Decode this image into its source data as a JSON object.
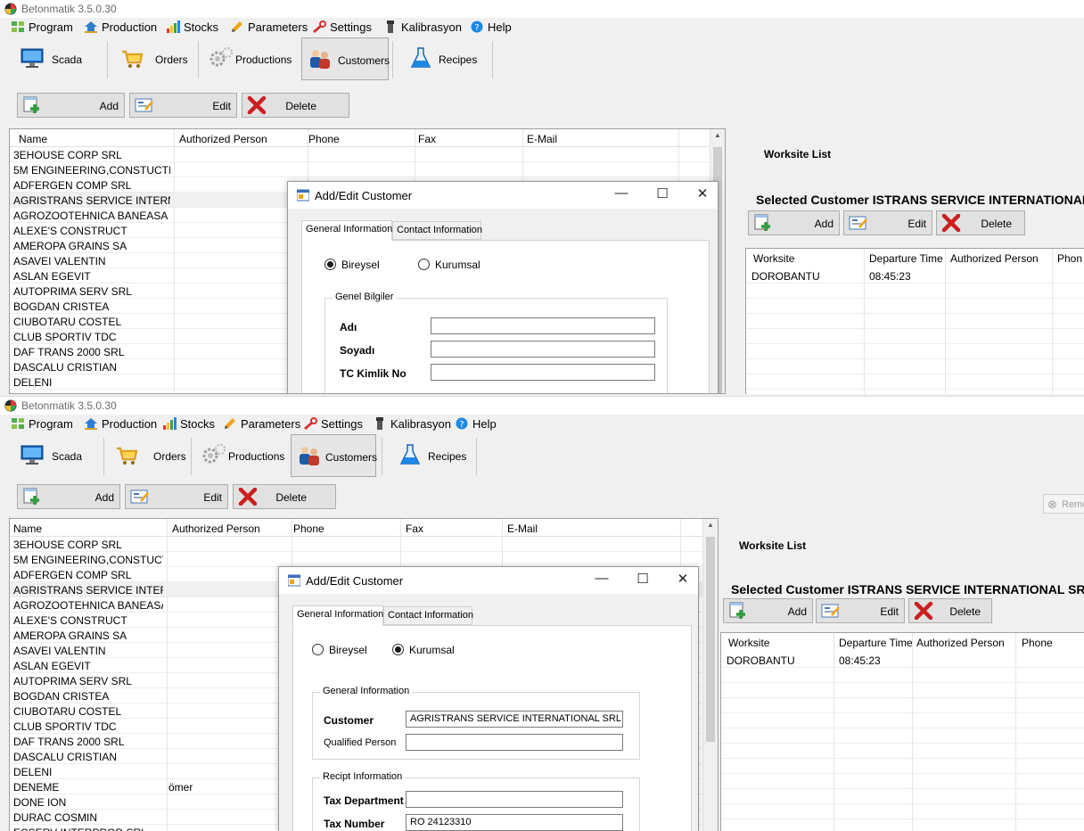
{
  "app": {
    "title": "Betonmatik 3.5.0.30"
  },
  "menu": [
    "Program",
    "Production",
    "Stocks",
    "Parameters",
    "Settings",
    "Kalibrasyon",
    "Help"
  ],
  "modules": [
    "Scada",
    "Orders",
    "Productions",
    "Customers",
    "Recipes"
  ],
  "toolbar": {
    "add": "Add",
    "edit": "Edit",
    "delete": "Delete"
  },
  "customer_columns": [
    "Name",
    "Authorized Person",
    "Phone",
    "Fax",
    "E-Mail"
  ],
  "customers": [
    {
      "name": "3EHOUSE CORP SRL",
      "person": ""
    },
    {
      "name": "5M ENGINEERING,CONSTUCTI...",
      "person": ""
    },
    {
      "name": "ADFERGEN COMP SRL",
      "person": ""
    },
    {
      "name": "AGRISTRANS SERVICE INTERN...",
      "person": ""
    },
    {
      "name": "AGROZOOTEHNICA BANEASA ...",
      "person": ""
    },
    {
      "name": "ALEXE'S CONSTRUCT",
      "person": ""
    },
    {
      "name": "AMEROPA GRAINS SA",
      "person": ""
    },
    {
      "name": "ASAVEI VALENTIN",
      "person": ""
    },
    {
      "name": "ASLAN EGEVIT",
      "person": ""
    },
    {
      "name": "AUTOPRIMA SERV SRL",
      "person": ""
    },
    {
      "name": "BOGDAN CRISTEA",
      "person": ""
    },
    {
      "name": "CIUBOTARU COSTEL",
      "person": ""
    },
    {
      "name": "CLUB SPORTIV TDC",
      "person": ""
    },
    {
      "name": "DAF TRANS 2000 SRL",
      "person": ""
    },
    {
      "name": "DASCALU CRISTIAN",
      "person": ""
    },
    {
      "name": "DELENI",
      "person": ""
    },
    {
      "name": "DENEME",
      "person": "ömer"
    },
    {
      "name": "DONE ION",
      "person": ""
    },
    {
      "name": "DURAC COSMIN",
      "person": ""
    },
    {
      "name": "ECSERV INTERPROD SRL",
      "person": ""
    }
  ],
  "worksite": {
    "list_label": "Worksite List",
    "selected_top": "Selected Customer ISTRANS SERVICE INTERNATIONAL",
    "selected_bottom": "Selected Customer ISTRANS SERVICE INTERNATIONAL SRL",
    "columns_top": [
      "Worksite",
      "Departure Time",
      "Authorized Person",
      "Phon"
    ],
    "columns_bottom": [
      "Worksite",
      "Departure Time",
      "Authorized Person",
      "Phone"
    ],
    "rows": [
      {
        "worksite": "DOROBANTU",
        "time": "08:45:23"
      }
    ]
  },
  "remove_button": "Remo",
  "dialog": {
    "title": "Add/Edit Customer",
    "tabs": [
      "General Information",
      "Contact Information"
    ],
    "top": {
      "radios": [
        "Bireysel",
        "Kurumsal"
      ],
      "selected": "Bireysel",
      "group": "Genel Bilgiler",
      "fields": [
        {
          "label": "Adı",
          "value": ""
        },
        {
          "label": "Soyadı",
          "value": ""
        },
        {
          "label": "TC Kimlik No",
          "value": ""
        }
      ]
    },
    "bottom": {
      "radios": [
        "Bireysel",
        "Kurumsal"
      ],
      "selected": "Kurumsal",
      "group1": "General Information",
      "customer_label": "Customer",
      "customer_value": "AGRISTRANS SERVICE INTERNATIONAL SRL",
      "qualified_label": "Qualified Person",
      "qualified_value": "",
      "group2": "Recipt Information",
      "tax_dept_label": "Tax Department",
      "tax_dept_value": "",
      "tax_number_label": "Tax Number",
      "tax_number_value": "RO 24123310"
    }
  },
  "colors": {
    "accent": "#0a64ad",
    "delete_red": "#cc1f1f",
    "window_bg": "#f0f0f0"
  }
}
